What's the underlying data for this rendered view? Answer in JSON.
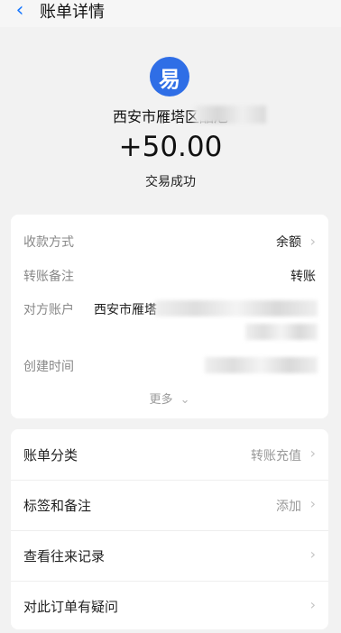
{
  "header": {
    "title": "账单详情",
    "back_icon": "chevron-left-icon"
  },
  "summary": {
    "logo_text": "易",
    "merchant": "西安市雁塔区酷旭",
    "amount": "+50.00",
    "status": "交易成功"
  },
  "details": {
    "rows": [
      {
        "label": "收款方式",
        "value": "余额"
      },
      {
        "label": "转账备注",
        "value": "转账"
      },
      {
        "label": "对方账户",
        "value": "西安市雁塔"
      },
      {
        "label": "创建时间",
        "value": ""
      }
    ],
    "more": "更多"
  },
  "menu": {
    "items": [
      {
        "label": "账单分类",
        "value": "转账充值"
      },
      {
        "label": "标签和备注",
        "value": "添加"
      },
      {
        "label": "查看往来记录",
        "value": ""
      },
      {
        "label": "对此订单有疑问",
        "value": ""
      }
    ]
  }
}
